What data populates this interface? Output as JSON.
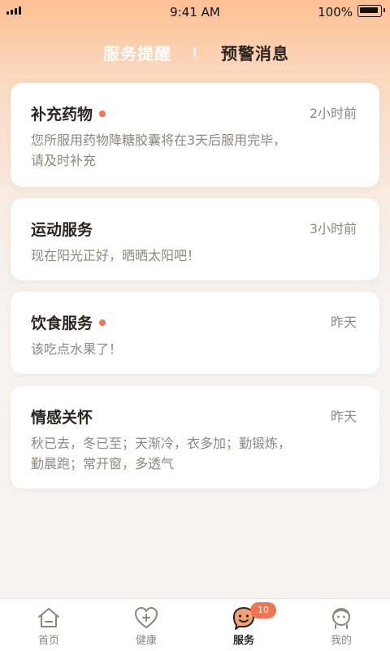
{
  "status_bar": {
    "time": "9:41 AM",
    "battery": "100%"
  },
  "tabs": [
    {
      "label": "服务提醒"
    },
    {
      "label": "预警消息"
    }
  ],
  "cards": [
    {
      "title": "补充药物",
      "time": "2小时前",
      "body": "您所服用药物降糖胶囊将在3天后服用完毕，请及时补充",
      "unread": true
    },
    {
      "title": "运动服务",
      "time": "3小时前",
      "body": "现在阳光正好，晒晒太阳吧！",
      "unread": false
    },
    {
      "title": "饮食服务",
      "time": "昨天",
      "body": "该吃点水果了！",
      "unread": true
    },
    {
      "title": "情感关怀",
      "time": "昨天",
      "body": "秋已去，冬已至；天渐冷，衣多加；勤锻炼，勤晨跑；常开窗，多透气",
      "unread": false
    }
  ],
  "nav": {
    "items": [
      {
        "label": "首页",
        "icon": "home-icon"
      },
      {
        "label": "健康",
        "icon": "health-heart-icon"
      },
      {
        "label": "服务",
        "icon": "service-face-icon",
        "badge": "10",
        "active": true
      },
      {
        "label": "我的",
        "icon": "profile-icon"
      }
    ]
  },
  "colors": {
    "accent": "#ef7450",
    "header_gradient_top": "#fdbf93"
  }
}
